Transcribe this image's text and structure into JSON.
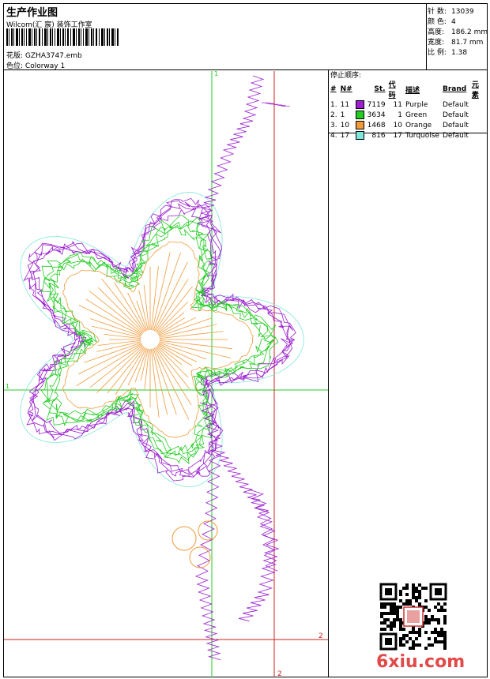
{
  "header": {
    "title": "生产作业图",
    "studio": "Wilcom(汇 宸) 装饰工作室",
    "pattern_label": "花版:",
    "pattern_value": "GZHA3747.emb",
    "colorway_label": "色位:",
    "colorway_value": "Colorway 1"
  },
  "stats": [
    {
      "label": "针 数:",
      "value": "13039"
    },
    {
      "label": "颜 色:",
      "value": "4"
    },
    {
      "label": "高度:",
      "value": "186.2 mm"
    },
    {
      "label": "宽度:",
      "value": "81.7 mm"
    },
    {
      "label": "比 例:",
      "value": "1.38"
    }
  ],
  "stop_sequence": {
    "title": "停止顺序:",
    "headers": {
      "idx": "#",
      "n": "N#",
      "st": "St.",
      "code": "代码",
      "desc": "描述",
      "brand": "Brand",
      "elem": "元素"
    },
    "rows": [
      {
        "idx": "1.",
        "n": "11",
        "color": "#9b1fd0",
        "st": "7119",
        "code": "11",
        "desc": "Purple",
        "brand": "Default"
      },
      {
        "idx": "2.",
        "n": "1",
        "color": "#22cc22",
        "st": "3634",
        "code": "1",
        "desc": "Green",
        "brand": "Default"
      },
      {
        "idx": "3.",
        "n": "10",
        "color": "#f09a3a",
        "st": "1468",
        "code": "10",
        "desc": "Orange",
        "brand": "Default"
      },
      {
        "idx": "4.",
        "n": "17",
        "color": "#7fe8d8",
        "st": "816",
        "code": "17",
        "desc": "Turquoise",
        "brand": "Default"
      }
    ]
  },
  "guides": {
    "green_label": "1",
    "red_label": "2",
    "green_color": "#22cc22",
    "red_color": "#cc2222"
  },
  "watermark": "6xiu.com"
}
